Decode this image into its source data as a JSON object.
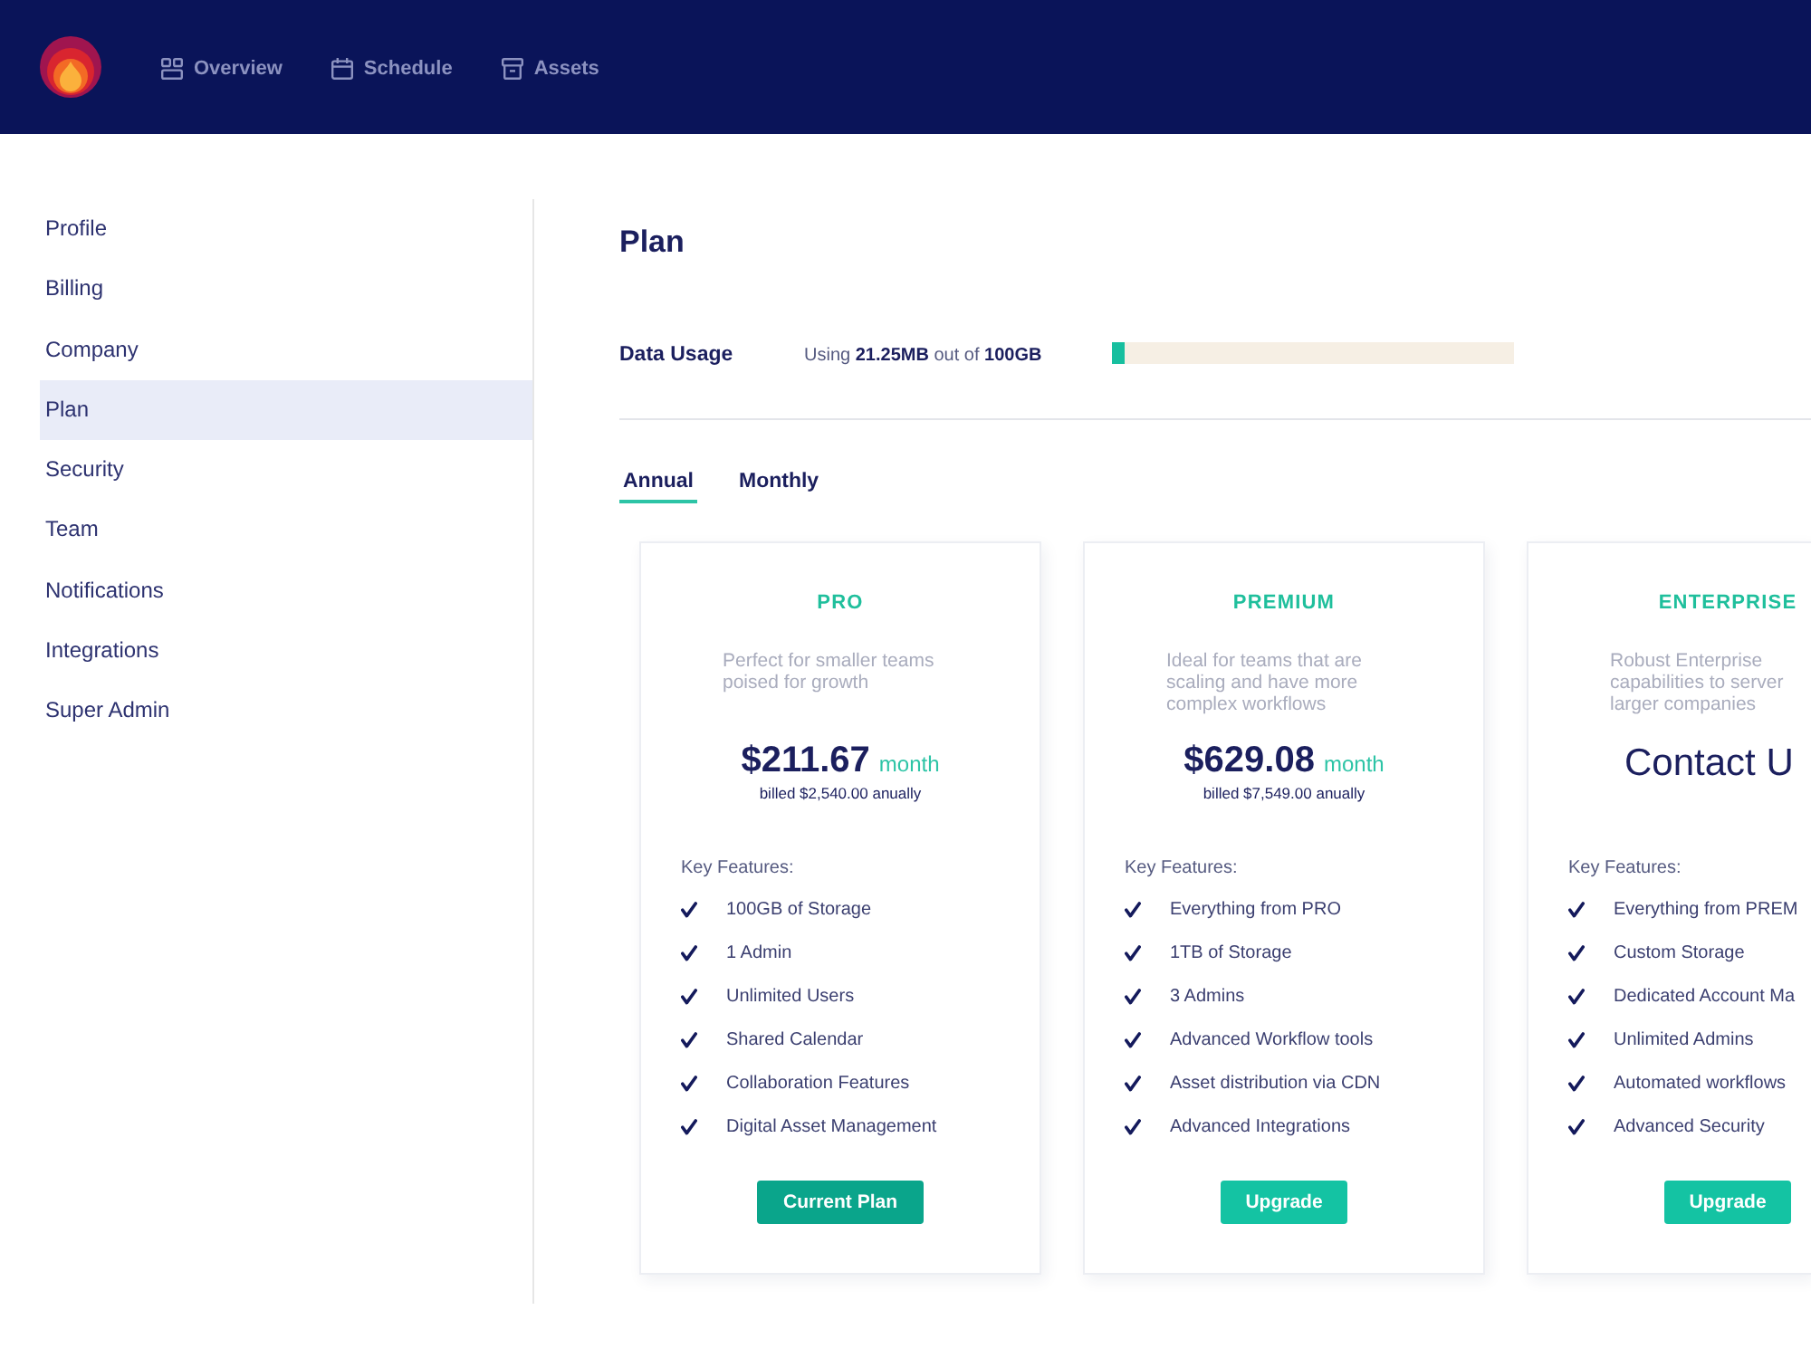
{
  "header": {
    "nav": [
      {
        "label": "Overview"
      },
      {
        "label": "Schedule"
      },
      {
        "label": "Assets"
      }
    ]
  },
  "sidebar": {
    "items": [
      {
        "label": "Profile",
        "selected": false
      },
      {
        "label": "Billing",
        "selected": false
      },
      {
        "label": "Company",
        "selected": false
      },
      {
        "label": "Plan",
        "selected": true
      },
      {
        "label": "Security",
        "selected": false
      },
      {
        "label": "Team",
        "selected": false
      },
      {
        "label": "Notifications",
        "selected": false
      },
      {
        "label": "Integrations",
        "selected": false
      },
      {
        "label": "Super Admin",
        "selected": false
      }
    ]
  },
  "page": {
    "title": "Plan"
  },
  "data_usage": {
    "label": "Data Usage",
    "reading": "Using **21.25MB** out of **100GB**",
    "level": 0.03
  },
  "billing_tabs": [
    {
      "label": "Annual",
      "selected": true
    },
    {
      "label": "Monthly",
      "selected": false
    }
  ],
  "plans": [
    {
      "kind": "price",
      "name": "PRO",
      "description": "Perfect for smaller teams poised for growth",
      "price": "$211.67",
      "period": "month",
      "billed": "billed $2,540.00 anually",
      "features_label": "Key Features:",
      "features": [
        "100GB of Storage",
        "1 Admin",
        "Unlimited Users",
        "Shared Calendar",
        "Collaboration Features",
        "Digital Asset Management"
      ],
      "button": {
        "label": "Current Plan",
        "current": true
      }
    },
    {
      "kind": "price",
      "name": "PREMIUM",
      "description": "Ideal for teams that are scaling and have more complex workflows",
      "price": "$629.08",
      "period": "month",
      "billed": "billed $7,549.00 anually",
      "features_label": "Key Features:",
      "features": [
        "Everything from PRO",
        "1TB of Storage",
        "3 Admins",
        "Advanced Workflow tools",
        "Asset distribution via CDN",
        "Advanced Integrations"
      ],
      "button": {
        "label": "Upgrade",
        "current": false
      }
    },
    {
      "kind": "contact",
      "name": "ENTERPRISE",
      "description": "Robust Enterprise capabilities to server larger companies",
      "contact": "Contact U",
      "features_label": "Key Features:",
      "features": [
        "Everything from PREM",
        "Custom Storage",
        "Dedicated Account Ma",
        "Unlimited Admins",
        "Automated workflows",
        "Advanced Security"
      ],
      "button": {
        "label": "Upgrade",
        "current": false
      }
    }
  ]
}
